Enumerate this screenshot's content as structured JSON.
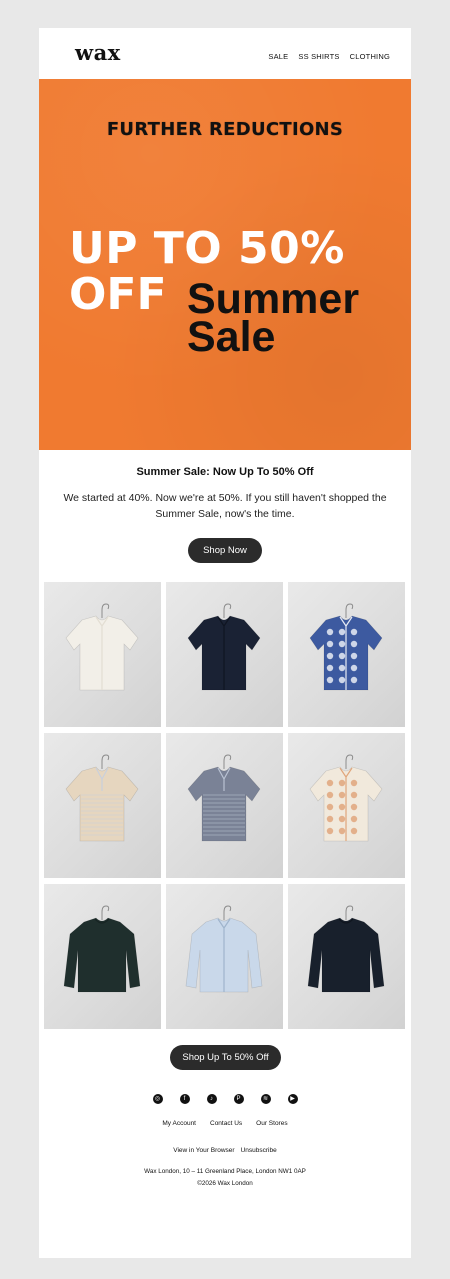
{
  "brand": {
    "logo": "wax"
  },
  "nav": {
    "items": [
      "SALE",
      "SS SHIRTS",
      "CLOTHING"
    ]
  },
  "hero": {
    "kicker": "FURTHER REDUCTIONS",
    "line1": "UP TO 50%",
    "line2": "OFF",
    "line3a": "Summer",
    "line3b": "Sale",
    "background_color": "#f07a30"
  },
  "content": {
    "headline": "Summer Sale: Now Up To 50% Off",
    "body": "We started at 40%. Now we're at 50%. If you still haven't shopped the Summer Sale, now's the time.",
    "cta": "Shop Now"
  },
  "products": [
    {
      "name": "cream-knit-shirt",
      "color": "#f2efe8",
      "accent": "#e3ded3",
      "kind": "shirt"
    },
    {
      "name": "navy-shirt",
      "color": "#1a2234",
      "accent": "#0f1522",
      "kind": "shirt"
    },
    {
      "name": "blue-pattern-shirt",
      "color": "#3d5aa0",
      "accent": "#e8ecf5",
      "kind": "shirt"
    },
    {
      "name": "beige-knit-polo",
      "color": "#e6d6bf",
      "accent": "#c9d0dc",
      "kind": "polo"
    },
    {
      "name": "grey-knit-polo",
      "color": "#7a8296",
      "accent": "#b9c2d3",
      "kind": "polo"
    },
    {
      "name": "cream-print-shirt",
      "color": "#f1e9dc",
      "accent": "#e0a67c",
      "kind": "shirt"
    },
    {
      "name": "green-sweatshirt",
      "color": "#1f2f2d",
      "accent": "#172423",
      "kind": "sweat"
    },
    {
      "name": "light-blue-overshirt",
      "color": "#c9d8ea",
      "accent": "#9fb4cc",
      "kind": "long"
    },
    {
      "name": "navy-henley",
      "color": "#18202c",
      "accent": "#0f151e",
      "kind": "sweat"
    }
  ],
  "footer": {
    "cta": "Shop Up To 50% Off",
    "socials": [
      "instagram-icon",
      "facebook-icon",
      "tiktok-icon",
      "pinterest-icon",
      "spotify-icon",
      "youtube-icon"
    ],
    "links": [
      "My Account",
      "Contact Us",
      "Our Stores"
    ],
    "links2": [
      "View in Your Browser",
      "Unsubscribe"
    ],
    "address": "Wax London, 10 – 11 Greenland Place, London NW1 0AP",
    "copyright": "©2026 Wax London"
  }
}
